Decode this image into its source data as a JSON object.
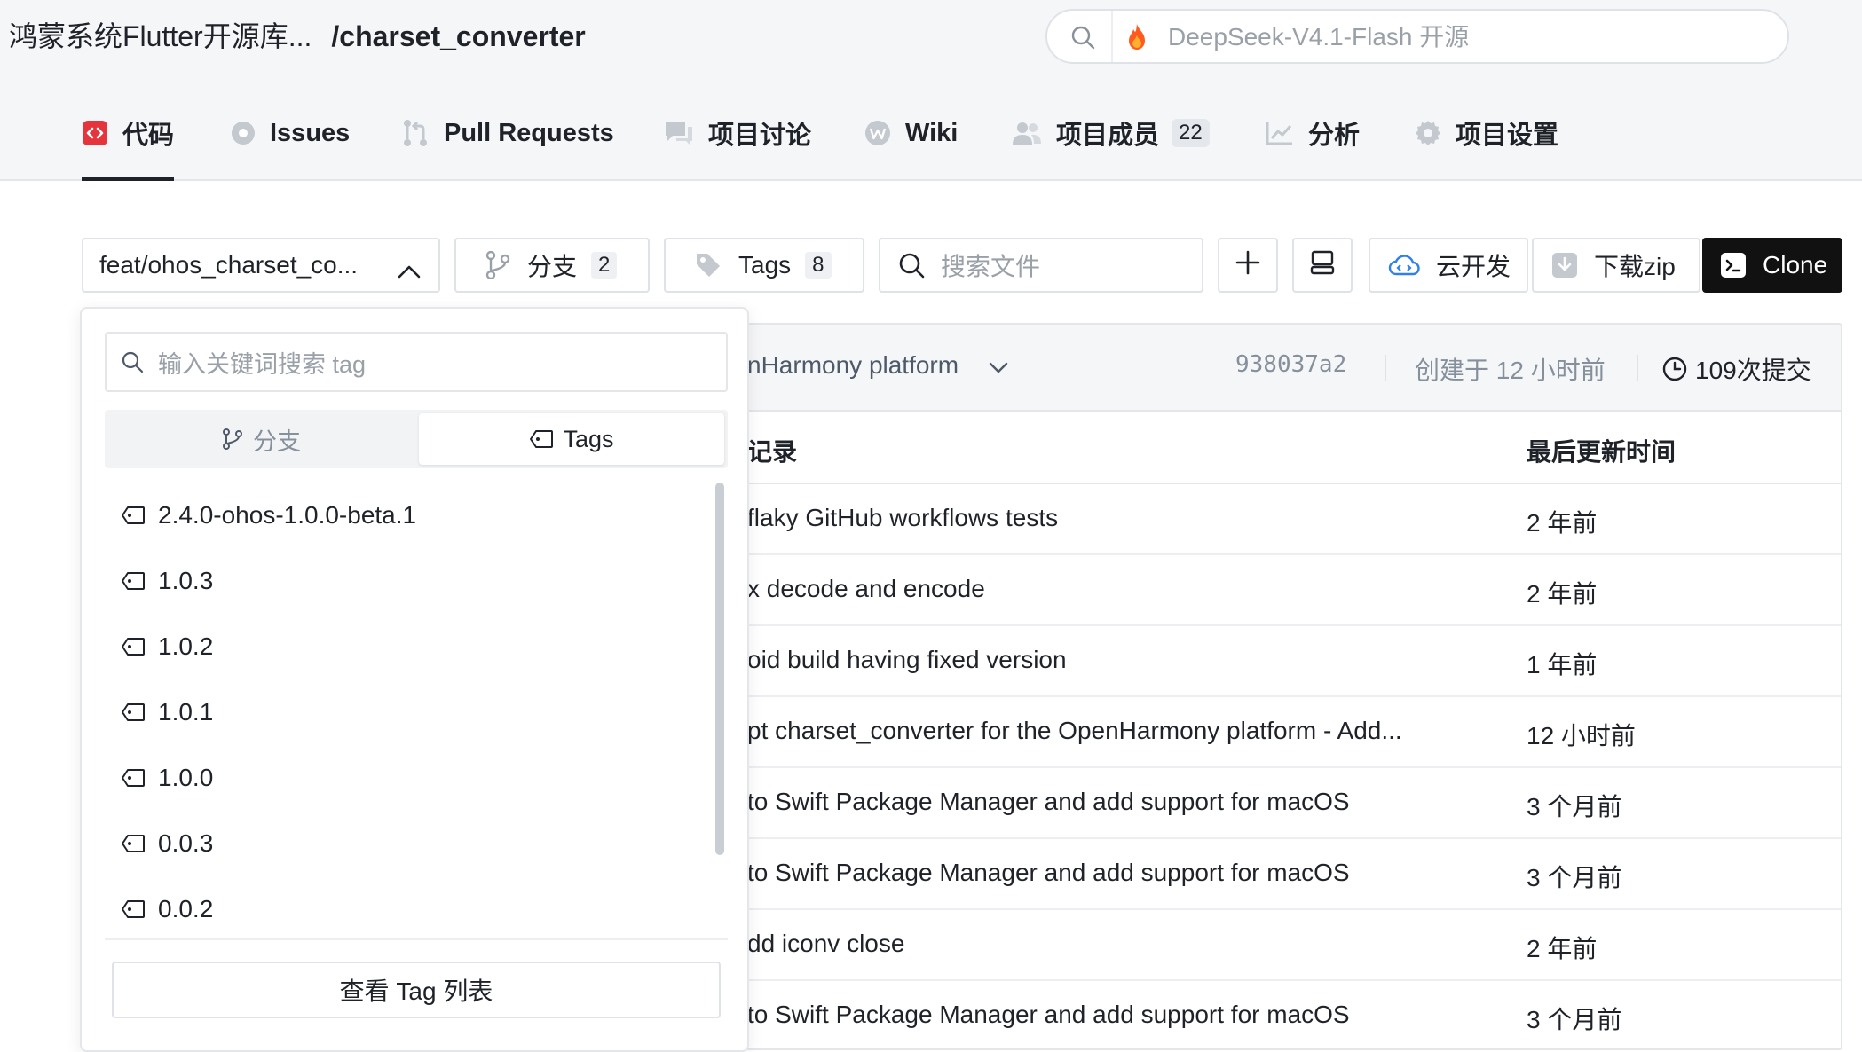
{
  "header": {
    "repo_owner": "鸿蒙系统Flutter开源库...",
    "repo_name": "/charset_converter",
    "global_search_placeholder": "DeepSeek-V4.1-Flash 开源",
    "icons": {
      "search": "search-icon",
      "promo": "fire-icon"
    }
  },
  "nav": {
    "tabs": [
      {
        "label": "代码",
        "icon": "code-icon",
        "active": true
      },
      {
        "label": "Issues",
        "icon": "issue-icon"
      },
      {
        "label": "Pull Requests",
        "icon": "pull-request-icon"
      },
      {
        "label": "项目讨论",
        "icon": "discussion-icon"
      },
      {
        "label": "Wiki",
        "icon": "wiki-icon"
      },
      {
        "label": "项目成员",
        "icon": "members-icon",
        "count": "22"
      },
      {
        "label": "分析",
        "icon": "chart-icon"
      },
      {
        "label": "项目设置",
        "icon": "gear-icon"
      }
    ]
  },
  "toolbar": {
    "branch": "feat/ohos_charset_co...",
    "branches_label": "分支",
    "branches_count": "2",
    "tags_label": "Tags",
    "tags_count": "8",
    "search_placeholder": "搜索文件",
    "cloud_label": "云开发",
    "download_label": "下载zip",
    "clone_label": "Clone"
  },
  "commit": {
    "message": "nHarmony platform",
    "hash": "938037a2",
    "created": "创建于 12 小时前",
    "count": "109次提交"
  },
  "table": {
    "headers": [
      "记录",
      "最后更新时间"
    ],
    "rows": [
      {
        "message": "flaky GitHub workflows tests",
        "time": "2 年前"
      },
      {
        "message": "x decode and encode",
        "time": "2 年前"
      },
      {
        "message": "oid build having fixed version",
        "time": "1 年前"
      },
      {
        "message": "pt charset_converter for the OpenHarmony platform - Add...",
        "time": "12 小时前"
      },
      {
        "message": "to Swift Package Manager and add support for macOS",
        "time": "3 个月前"
      },
      {
        "message": "to Swift Package Manager and add support for macOS",
        "time": "3 个月前"
      },
      {
        "message": "dd iconv close",
        "time": "2 年前"
      },
      {
        "message": "to Swift Package Manager and add support for macOS",
        "time": "3 个月前"
      }
    ]
  },
  "dropdown": {
    "search_placeholder": "输入关键词搜索 tag",
    "segments": {
      "branches": "分支",
      "tags": "Tags",
      "active": "tags"
    },
    "tags": [
      "2.4.0-ohos-1.0.0-beta.1",
      "1.0.3",
      "1.0.2",
      "1.0.1",
      "1.0.0",
      "0.0.3",
      "0.0.2"
    ],
    "footer_button": "查看 Tag 列表"
  },
  "colors": {
    "accent_red": "#e5343c",
    "clone_bg": "#111111",
    "nav_bg": "#f5f6f8"
  }
}
